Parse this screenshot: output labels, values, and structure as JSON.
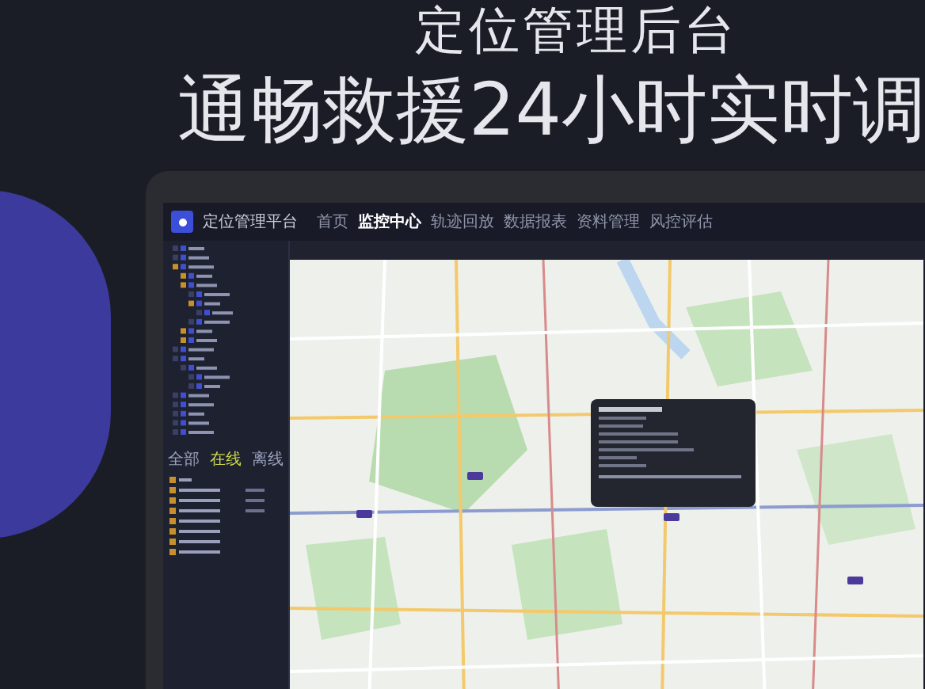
{
  "headline": {
    "title": "定位管理后台",
    "subtitle": "通畅救援24小时实时调"
  },
  "app": {
    "brand": "定位管理平台",
    "nav": [
      {
        "label": "首页",
        "selected": false
      },
      {
        "label": "监控中心",
        "selected": true
      },
      {
        "label": "轨迹回放",
        "selected": false
      },
      {
        "label": "数据报表",
        "selected": false
      },
      {
        "label": "资料管理",
        "selected": false
      },
      {
        "label": "风控评估",
        "selected": false
      }
    ],
    "status_tabs": [
      {
        "label": "全部",
        "selected": false
      },
      {
        "label": "在线",
        "selected": true
      },
      {
        "label": "离线",
        "selected": false
      }
    ]
  }
}
